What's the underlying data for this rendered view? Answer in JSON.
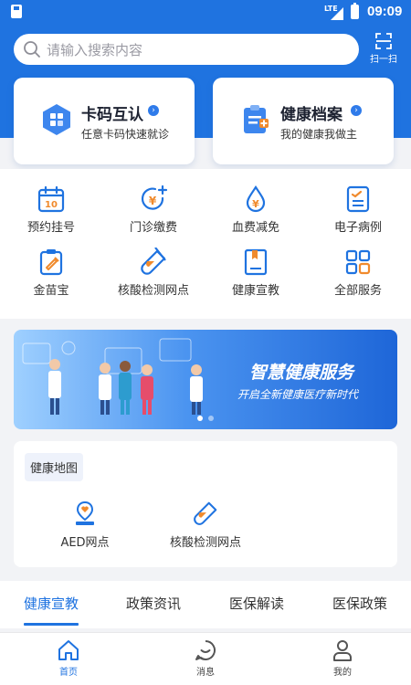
{
  "status_bar": {
    "network": "LTE",
    "time": "09:09"
  },
  "header": {
    "search_placeholder": "请输入搜索内容",
    "scan_label": "扫一扫"
  },
  "cards": [
    {
      "title": "卡码互认",
      "subtitle": "任意卡码快速就诊",
      "icon": "card-grid-icon"
    },
    {
      "title": "健康档案",
      "subtitle": "我的健康我做主",
      "icon": "health-record-icon"
    }
  ],
  "services": [
    {
      "label": "预约挂号",
      "icon": "calendar-icon"
    },
    {
      "label": "门诊缴费",
      "icon": "payment-icon"
    },
    {
      "label": "血费减免",
      "icon": "blood-drop-icon"
    },
    {
      "label": "电子病例",
      "icon": "medical-record-icon"
    },
    {
      "label": "金苗宝",
      "icon": "vaccine-icon"
    },
    {
      "label": "核酸检测网点",
      "icon": "test-tube-icon"
    },
    {
      "label": "健康宣教",
      "icon": "book-icon"
    },
    {
      "label": "全部服务",
      "icon": "grid-icon"
    }
  ],
  "banner": {
    "title": "智慧健康服务",
    "subtitle": "开启全新健康医疗新时代",
    "slide_count": 2,
    "active_slide": 1
  },
  "health_map": {
    "title": "健康地图",
    "items": [
      {
        "label": "AED网点",
        "icon": "aed-location-icon"
      },
      {
        "label": "核酸检测网点",
        "icon": "test-tube-icon"
      }
    ]
  },
  "tabs": [
    {
      "label": "健康宣教",
      "active": true
    },
    {
      "label": "政策资讯",
      "active": false
    },
    {
      "label": "医保解读",
      "active": false
    },
    {
      "label": "医保政策",
      "active": false
    }
  ],
  "bottom_nav": [
    {
      "label": "首页",
      "icon": "home-icon",
      "active": true
    },
    {
      "label": "消息",
      "icon": "message-icon",
      "active": false
    },
    {
      "label": "我的",
      "icon": "user-icon",
      "active": false
    }
  ],
  "colors": {
    "primary": "#1f73e0",
    "accent_orange": "#f08a2c"
  }
}
